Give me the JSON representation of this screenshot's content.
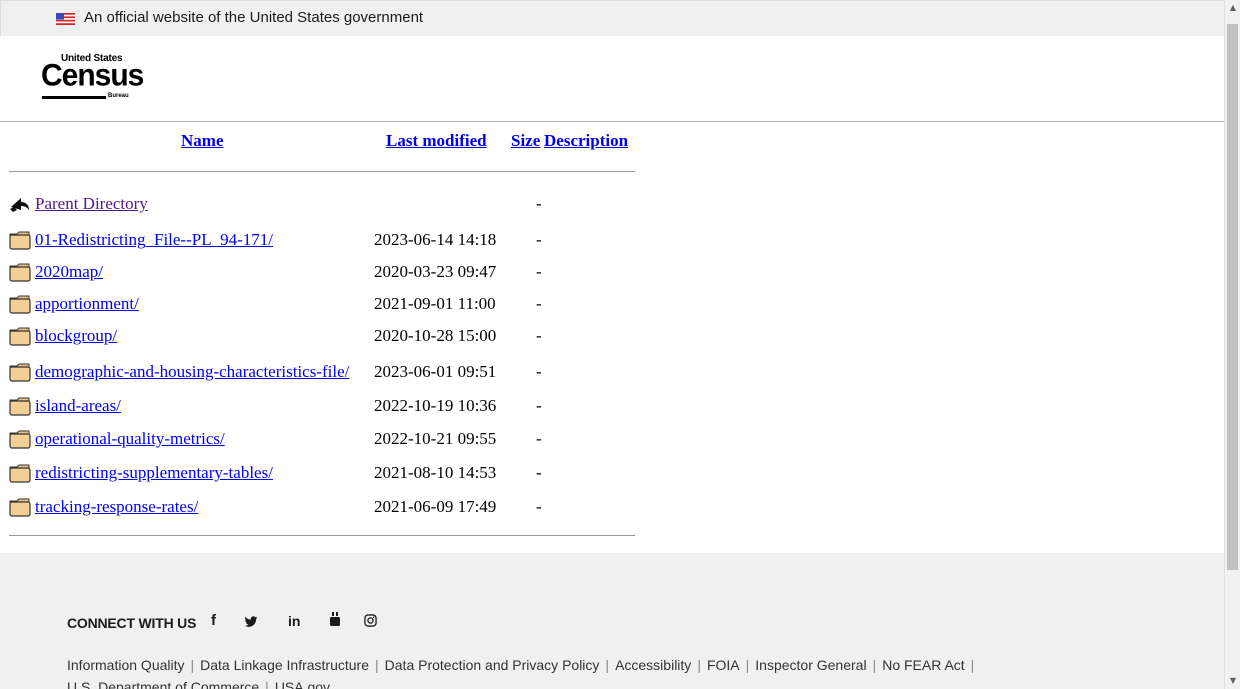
{
  "gov_banner": {
    "text": "An official website of the United States government"
  },
  "logo": {
    "top": "United States",
    "main": "Census",
    "bureau": "Bureau"
  },
  "table": {
    "headers": {
      "name": "Name",
      "last_modified": "Last modified",
      "size": "Size",
      "description": "Description"
    },
    "rows": [
      {
        "name": "Parent Directory",
        "modified": "",
        "size": "-",
        "icon": "back-arrow-icon"
      },
      {
        "name": "01-Redistricting_File--PL_94-171/",
        "modified": "2023-06-14 14:18",
        "size": "-",
        "icon": "folder-icon"
      },
      {
        "name": "2020map/",
        "modified": "2020-03-23 09:47",
        "size": "-",
        "icon": "folder-icon"
      },
      {
        "name": "apportionment/",
        "modified": "2021-09-01 11:00",
        "size": "-",
        "icon": "folder-icon"
      },
      {
        "name": "blockgroup/",
        "modified": "2020-10-28 15:00",
        "size": "-",
        "icon": "folder-icon"
      },
      {
        "name": "demographic-and-housing-characteristics-file/",
        "modified": "2023-06-01 09:51",
        "size": "-",
        "icon": "folder-icon"
      },
      {
        "name": "island-areas/",
        "modified": "2022-10-19 10:36",
        "size": "-",
        "icon": "folder-icon"
      },
      {
        "name": "operational-quality-metrics/",
        "modified": "2022-10-21 09:55",
        "size": "-",
        "icon": "folder-icon"
      },
      {
        "name": "redistricting-supplementary-tables/",
        "modified": "2021-08-10 14:53",
        "size": "-",
        "icon": "folder-icon"
      },
      {
        "name": "tracking-response-rates/",
        "modified": "2021-06-09 17:49",
        "size": "-",
        "icon": "folder-icon"
      }
    ]
  },
  "footer": {
    "connect_label": "CONNECT WITH US",
    "social": [
      {
        "label": "f",
        "icon": "facebook-icon"
      },
      {
        "label": "𝕏",
        "icon": "twitter-icon"
      },
      {
        "label": "in",
        "icon": "linkedin-icon"
      },
      {
        "label": "You Tube",
        "icon": "youtube-icon"
      },
      {
        "label": "instagram",
        "icon": "instagram-icon"
      }
    ],
    "links_line1": [
      "Information Quality",
      "Data Linkage Infrastructure",
      "Data Protection and Privacy Policy",
      "Accessibility",
      "FOIA",
      "Inspector General",
      "No FEAR Act"
    ],
    "links_line2": [
      "U.S. Department of Commerce",
      "USA.gov"
    ]
  },
  "colors": {
    "link": "#0000ee",
    "visited": "#551a8b",
    "footer_bg": "#f0f0f0",
    "banner_bg": "#f0f0f0"
  }
}
